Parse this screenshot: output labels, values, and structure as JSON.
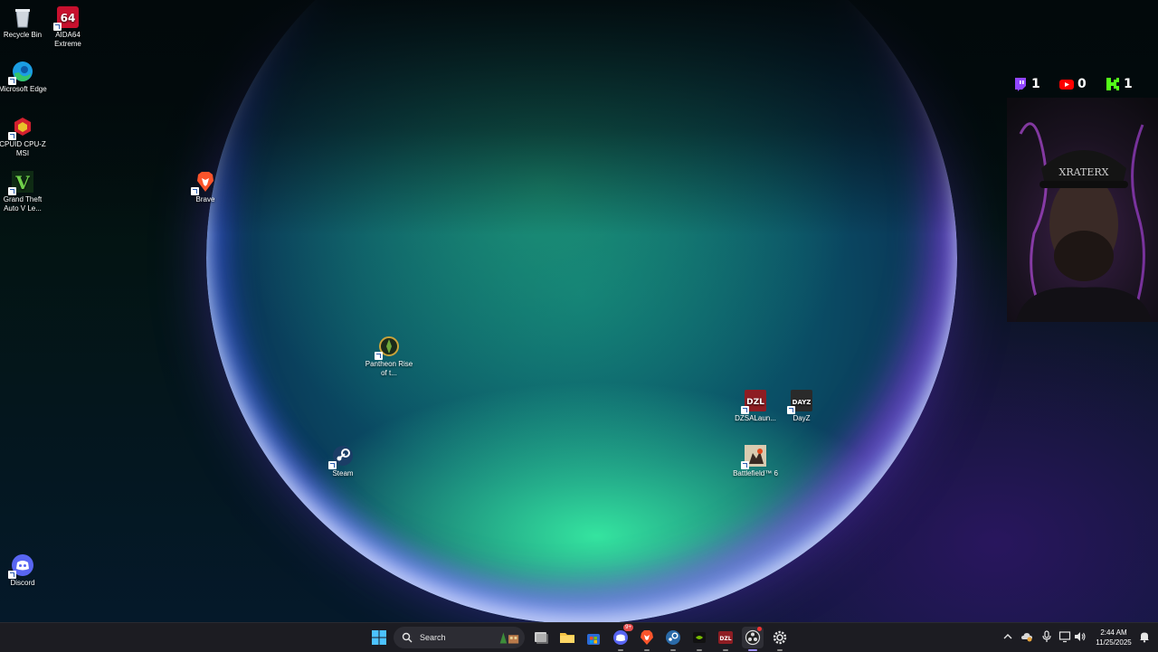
{
  "desktop": {
    "icons": [
      {
        "id": "recycle-bin",
        "label": "Recycle Bin"
      },
      {
        "id": "aida64",
        "label": "AIDA64 Extreme"
      },
      {
        "id": "edge",
        "label": "Microsoft Edge"
      },
      {
        "id": "cpuz",
        "label": "CPUID CPU-Z MSI"
      },
      {
        "id": "gta",
        "label": "Grand Theft Auto V Le..."
      },
      {
        "id": "brave",
        "label": "Brave"
      },
      {
        "id": "pantheon",
        "label": "Pantheon Rise of t..."
      },
      {
        "id": "steam",
        "label": "Steam"
      },
      {
        "id": "dzsa",
        "label": "DZSALaun..."
      },
      {
        "id": "dayz",
        "label": "DayZ"
      },
      {
        "id": "battlefield",
        "label": "Battlefield™ 6"
      },
      {
        "id": "discord",
        "label": "Discord"
      }
    ],
    "icon_glyphs": {
      "aida64": "64",
      "dzsa": "DZL",
      "dayz": "DAYZ",
      "gta": "V"
    }
  },
  "overlay": {
    "twitch_count": "1",
    "youtube_count": "0",
    "kick_count": "1",
    "webcam_cap_text": "XRATERX",
    "colors": {
      "twitch": "#9146ff",
      "youtube": "#ff0000",
      "kick": "#53fc18"
    }
  },
  "taskbar": {
    "search_placeholder": "Search",
    "clock_time": "2:44 AM",
    "clock_date": "11/25/2025",
    "discord_badge": "9+"
  }
}
